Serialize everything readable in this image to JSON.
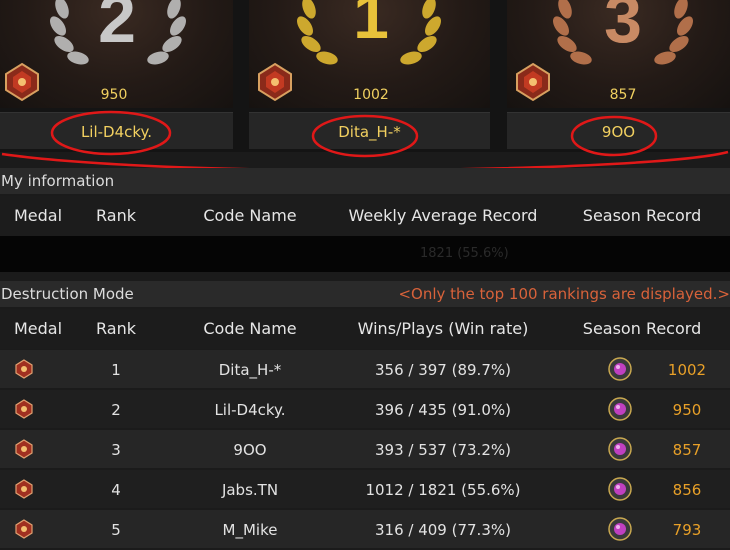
{
  "podium": [
    {
      "place_label": "2",
      "score": "950",
      "name": "Lil-D4cky."
    },
    {
      "place_label": "1",
      "score": "1002",
      "name": "Dita_H-*"
    },
    {
      "place_label": "3",
      "score": "857",
      "name": "9OO"
    }
  ],
  "my_info": {
    "title": "My information",
    "columns": [
      "Medal",
      "Rank",
      "Code Name",
      "Weekly Average Record",
      "Season Record"
    ],
    "redacted_hint": "1821 (55.6%)"
  },
  "destruction": {
    "title": "Destruction Mode",
    "notice": "<Only the top 100 rankings are displayed.>",
    "columns": [
      "Medal",
      "Rank",
      "Code Name",
      "Wins/Plays (Win rate)",
      "Season Record"
    ],
    "rows": [
      {
        "rank": "1",
        "name": "Dita_H-*",
        "record": "356 / 397 (89.7%)",
        "season": "1002"
      },
      {
        "rank": "2",
        "name": "Lil-D4cky.",
        "record": "396 / 435 (91.0%)",
        "season": "950"
      },
      {
        "rank": "3",
        "name": "9OO",
        "record": "393 / 537 (73.2%)",
        "season": "857"
      },
      {
        "rank": "4",
        "name": "Jabs.TN",
        "record": "1012 / 1821 (55.6%)",
        "season": "856"
      },
      {
        "rank": "5",
        "name": "M_Mike",
        "record": "316 / 409 (77.3%)",
        "season": "793"
      }
    ]
  },
  "colors": {
    "gold": "#f0d060",
    "orange": "#e8a028",
    "annotation_red": "#e01818"
  },
  "icons": [
    "laurel-silver-icon",
    "laurel-gold-icon",
    "laurel-bronze-icon",
    "rank-medal-icon",
    "season-gem-icon"
  ]
}
